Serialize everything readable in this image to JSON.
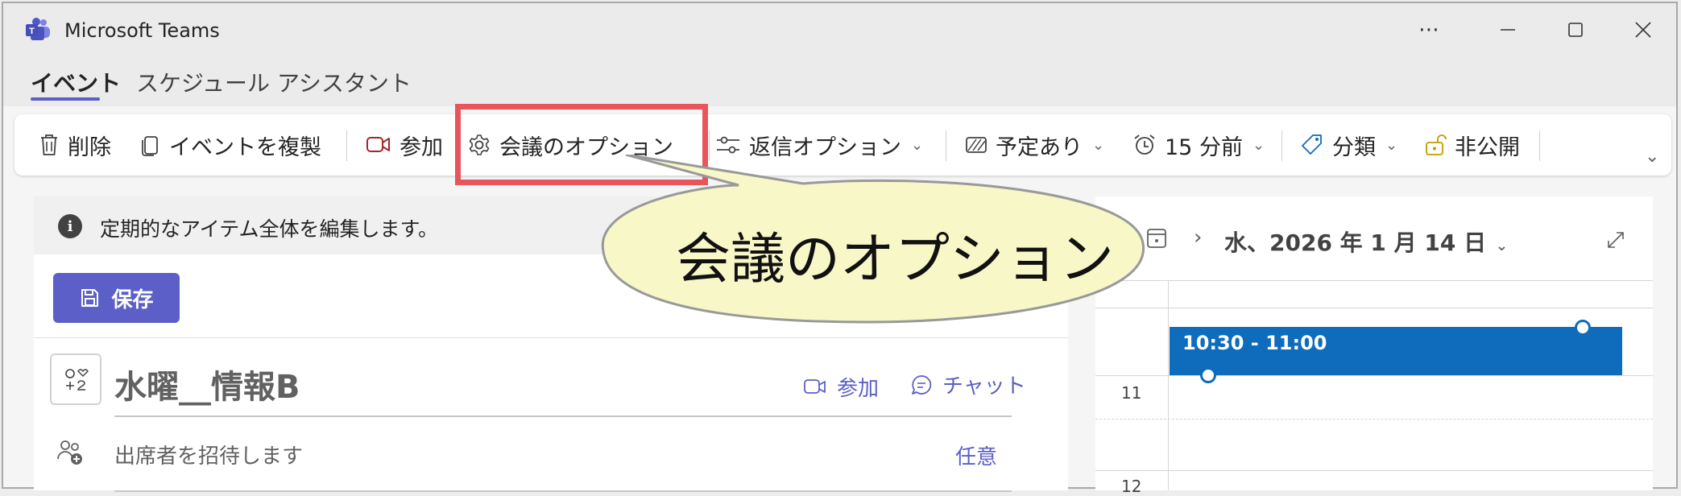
{
  "window": {
    "title": "Microsoft Teams"
  },
  "tabs": [
    {
      "label": "イベント",
      "active": true
    },
    {
      "label": "スケジュール アシスタント",
      "active": false
    }
  ],
  "toolbar": {
    "delete": "削除",
    "duplicate": "イベントを複製",
    "join": "参加",
    "meeting_options": "会議のオプション",
    "response_options": "返信オプション",
    "show_as": "予定あり",
    "reminder": "15 分前",
    "category": "分類",
    "private": "非公開"
  },
  "callout": {
    "text": "会議のオプション"
  },
  "form": {
    "info_message": "定期的なアイテム全体を編集します。",
    "save_label": "保存",
    "title": "水曜__情報B",
    "join_label": "参加",
    "chat_label": "チャット",
    "attendees_placeholder": "出席者を招待します",
    "optional_label": "任意"
  },
  "calendar": {
    "date": "水、2026 年 1 月 14 日",
    "event_time": "10:30 - 11:00",
    "hours": [
      "11",
      "12"
    ]
  },
  "colors": {
    "accent": "#5b5fc7",
    "event": "#0f6cbd",
    "highlight": "#e8555a",
    "callout_fill": "#f7f7c8"
  }
}
